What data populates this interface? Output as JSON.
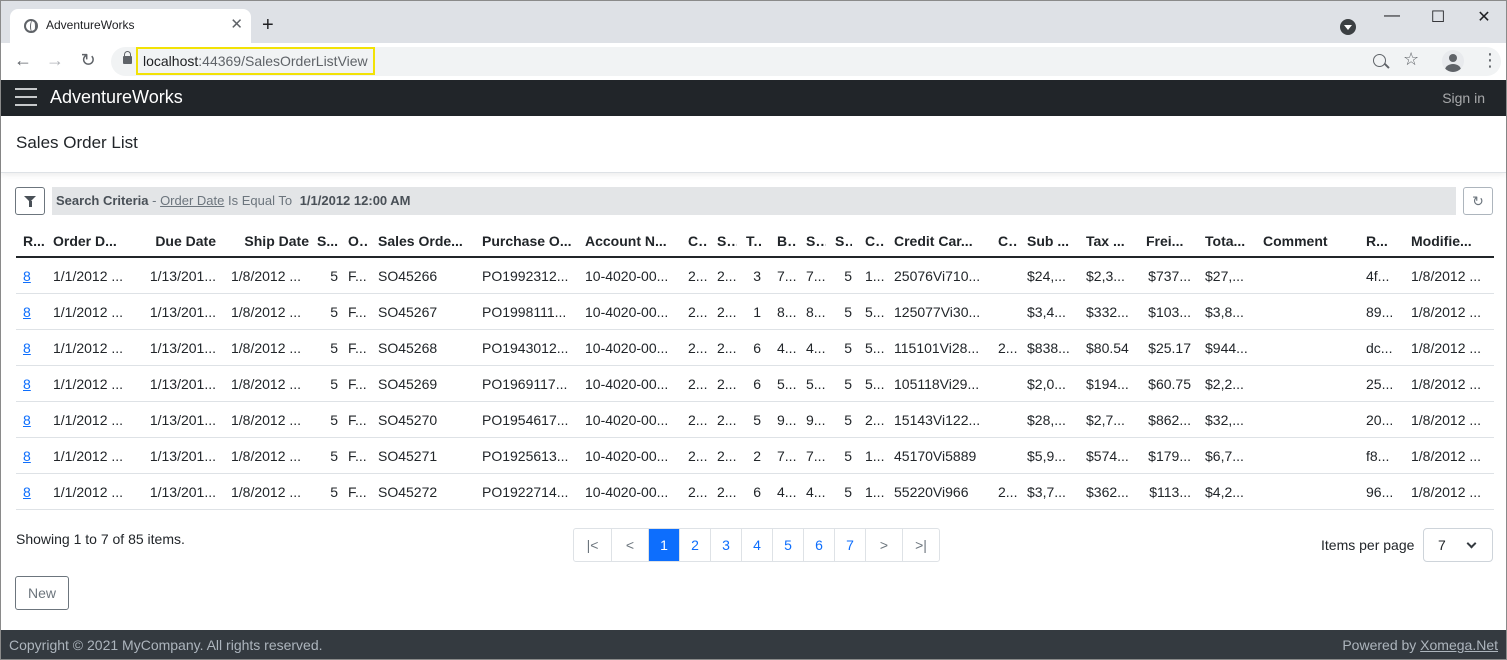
{
  "browser": {
    "tab_title": "AdventureWorks",
    "url_host": "localhost",
    "url_rest": ":44369/SalesOrderListView"
  },
  "app": {
    "brand": "AdventureWorks",
    "signin": "Sign in"
  },
  "page": {
    "title": "Sales Order List",
    "criteria_label": "Search Criteria",
    "criteria_sep": " - ",
    "criteria_field": "Order Date",
    "criteria_op": " Is Equal To ",
    "criteria_value": "1/1/2012 12:00 AM"
  },
  "grid": {
    "headers": [
      "R...",
      "Order D...",
      "Due Date",
      "Ship Date",
      "S...",
      "O...",
      "Sales Orde...",
      "Purchase O...",
      "Account N...",
      "C...",
      "S...",
      "T...",
      "B...",
      "S...",
      "S...",
      "C...",
      "Credit Car...",
      "C...",
      "Sub ...",
      "Tax ...",
      "Frei...",
      "Tota...",
      "Comment",
      "R...",
      "Modifie..."
    ],
    "rows": [
      [
        "8",
        "1/1/2012 ...",
        "1/13/201...",
        "1/8/2012 ...",
        "5",
        "F...",
        "SO45266",
        "PO1992312...",
        "10-4020-00...",
        "2...",
        "2...",
        "3",
        "7...",
        "7...",
        "5",
        "1...",
        "25076Vi710...",
        "",
        "$24,...",
        "$2,3...",
        "$737...",
        "$27,...",
        "",
        "4f...",
        "1/8/2012 ..."
      ],
      [
        "8",
        "1/1/2012 ...",
        "1/13/201...",
        "1/8/2012 ...",
        "5",
        "F...",
        "SO45267",
        "PO1998111...",
        "10-4020-00...",
        "2...",
        "2...",
        "1",
        "8...",
        "8...",
        "5",
        "5...",
        "125077Vi30...",
        "",
        "$3,4...",
        "$332...",
        "$103...",
        "$3,8...",
        "",
        "89...",
        "1/8/2012 ..."
      ],
      [
        "8",
        "1/1/2012 ...",
        "1/13/201...",
        "1/8/2012 ...",
        "5",
        "F...",
        "SO45268",
        "PO1943012...",
        "10-4020-00...",
        "2...",
        "2...",
        "6",
        "4...",
        "4...",
        "5",
        "5...",
        "115101Vi28...",
        "2...",
        "$838...",
        "$80.54",
        "$25.17",
        "$944...",
        "",
        "dc...",
        "1/8/2012 ..."
      ],
      [
        "8",
        "1/1/2012 ...",
        "1/13/201...",
        "1/8/2012 ...",
        "5",
        "F...",
        "SO45269",
        "PO1969117...",
        "10-4020-00...",
        "2...",
        "2...",
        "6",
        "5...",
        "5...",
        "5",
        "5...",
        "105118Vi29...",
        "",
        "$2,0...",
        "$194...",
        "$60.75",
        "$2,2...",
        "",
        "25...",
        "1/8/2012 ..."
      ],
      [
        "8",
        "1/1/2012 ...",
        "1/13/201...",
        "1/8/2012 ...",
        "5",
        "F...",
        "SO45270",
        "PO1954617...",
        "10-4020-00...",
        "2...",
        "2...",
        "5",
        "9...",
        "9...",
        "5",
        "2...",
        "15143Vi122...",
        "",
        "$28,...",
        "$2,7...",
        "$862...",
        "$32,...",
        "",
        "20...",
        "1/8/2012 ..."
      ],
      [
        "8",
        "1/1/2012 ...",
        "1/13/201...",
        "1/8/2012 ...",
        "5",
        "F...",
        "SO45271",
        "PO1925613...",
        "10-4020-00...",
        "2...",
        "2...",
        "2",
        "7...",
        "7...",
        "5",
        "1...",
        "45170Vi5889",
        "",
        "$5,9...",
        "$574...",
        "$179...",
        "$6,7...",
        "",
        "f8...",
        "1/8/2012 ..."
      ],
      [
        "8",
        "1/1/2012 ...",
        "1/13/201...",
        "1/8/2012 ...",
        "5",
        "F...",
        "SO45272",
        "PO1922714...",
        "10-4020-00...",
        "2...",
        "2...",
        "6",
        "4...",
        "4...",
        "5",
        "1...",
        "55220Vi966",
        "2...",
        "$3,7...",
        "$362...",
        "$113...",
        "$4,2...",
        "",
        "96...",
        "1/8/2012 ..."
      ]
    ]
  },
  "pager": {
    "showing": "Showing 1 to 7 of 85 items.",
    "first": "|<",
    "prev": "<",
    "pages": [
      "1",
      "2",
      "3",
      "4",
      "5",
      "6",
      "7"
    ],
    "active_page": "1",
    "next": ">",
    "last": ">|",
    "items_per_page_label": "Items per page",
    "items_per_page_value": "7"
  },
  "actions": {
    "new_label": "New"
  },
  "footer": {
    "copyright": "Copyright © 2021 MyCompany. All rights reserved.",
    "powered_by": "Powered by ",
    "powered_link": "Xomega.Net"
  }
}
